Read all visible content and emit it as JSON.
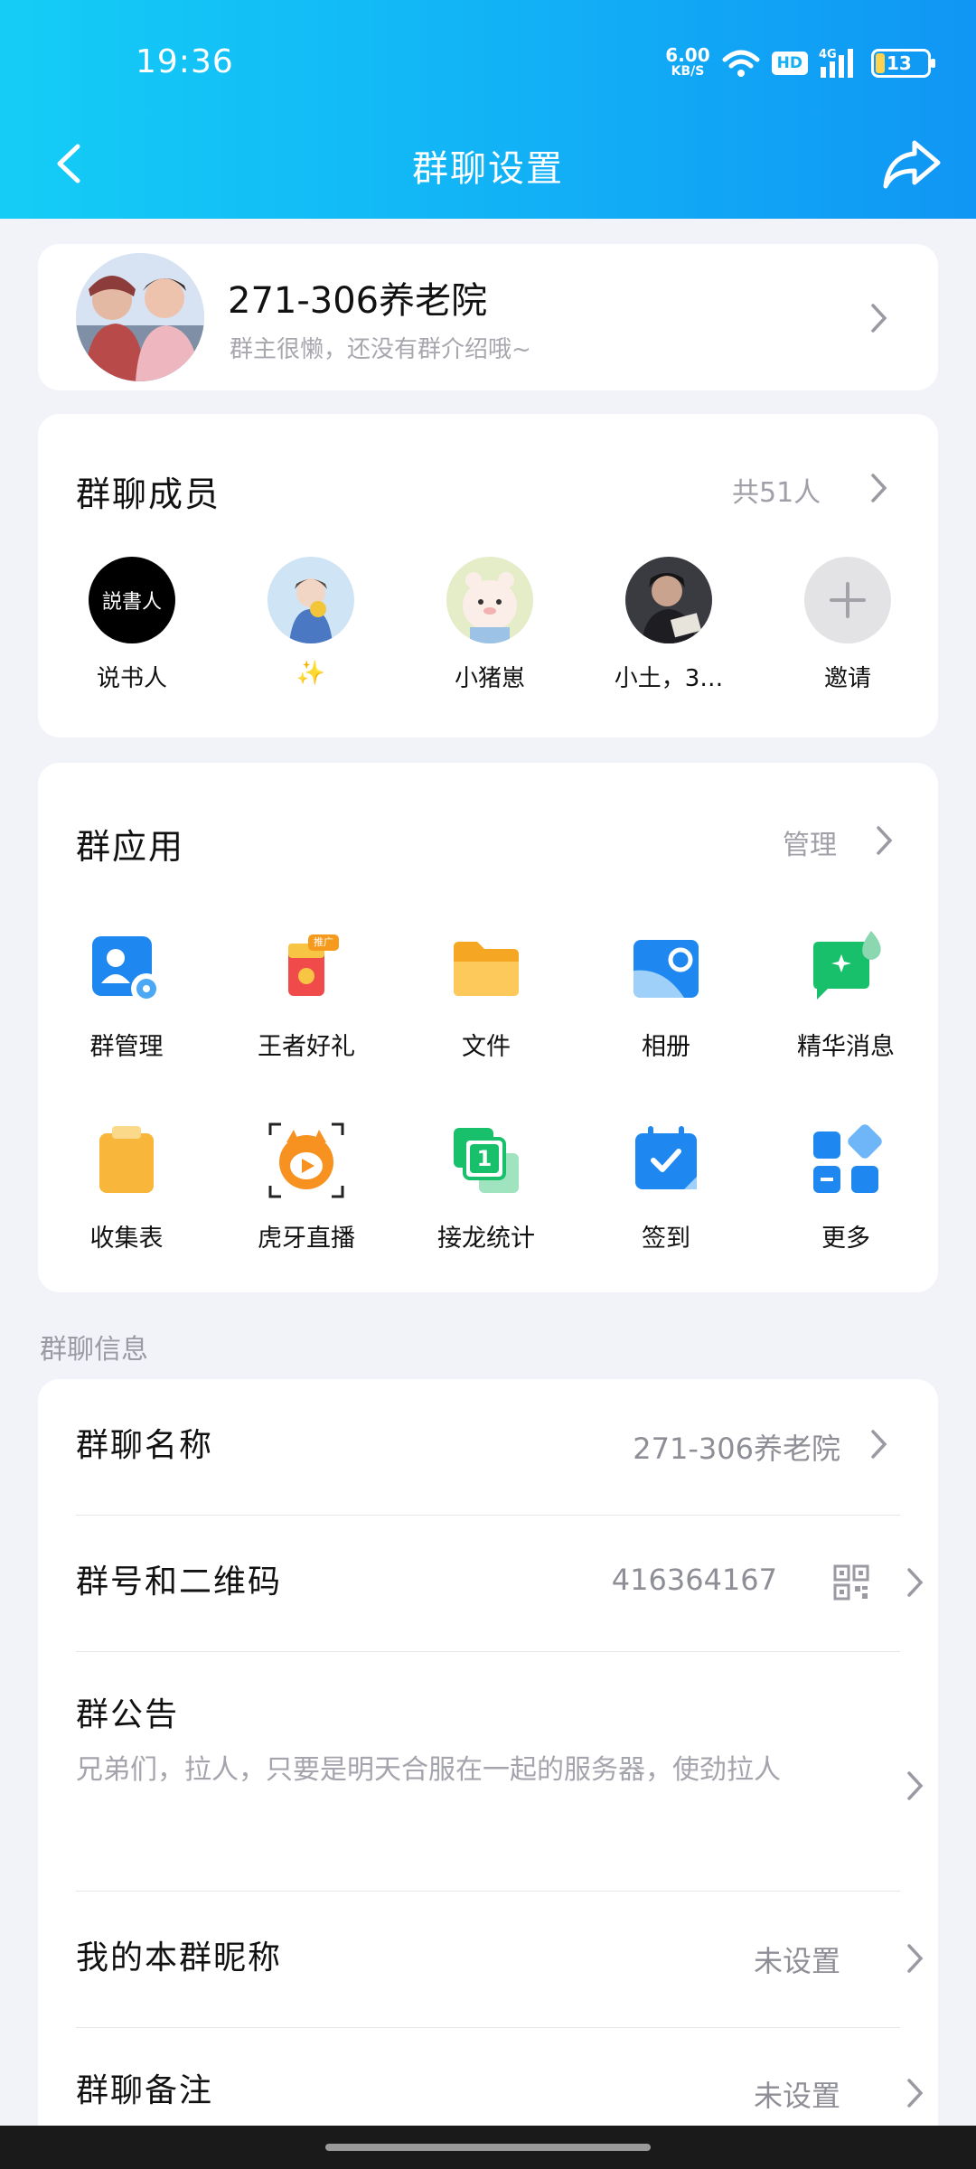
{
  "status_bar": {
    "time": "19:36",
    "speed_value": "6.00",
    "speed_unit": "KB/S",
    "hd": "HD",
    "network": "4G",
    "battery": "13"
  },
  "nav": {
    "title": "群聊设置"
  },
  "group": {
    "name": "271-306养老院",
    "description": "群主很懒，还没有群介绍哦~"
  },
  "members": {
    "title": "群聊成员",
    "count": "共51人",
    "list": [
      {
        "name": "说书人",
        "avatar_text": "説書人"
      },
      {
        "name": "✨"
      },
      {
        "name": "小猪崽"
      },
      {
        "name": "小土，3…"
      }
    ],
    "invite_label": "邀请"
  },
  "apps": {
    "title": "群应用",
    "manage": "管理",
    "items": [
      {
        "label": "群管理",
        "icon": "group-manage-icon"
      },
      {
        "label": "王者好礼",
        "icon": "gift-icon",
        "badge": "推广"
      },
      {
        "label": "文件",
        "icon": "folder-icon"
      },
      {
        "label": "相册",
        "icon": "album-icon"
      },
      {
        "label": "精华消息",
        "icon": "essence-message-icon"
      },
      {
        "label": "收集表",
        "icon": "clipboard-icon"
      },
      {
        "label": "虎牙直播",
        "icon": "huya-live-icon"
      },
      {
        "label": "接龙统计",
        "icon": "relay-stats-icon",
        "badge": "1"
      },
      {
        "label": "签到",
        "icon": "calendar-checkin-icon"
      },
      {
        "label": "更多",
        "icon": "more-apps-icon"
      }
    ]
  },
  "info": {
    "section_label": "群聊信息",
    "name_label": "群聊名称",
    "name_value": "271-306养老院",
    "number_label": "群号和二维码",
    "number_value": "416364167",
    "notice_label": "群公告",
    "notice_text": "兄弟们，拉人，只要是明天合服在一起的服务器，使劲拉人",
    "nickname_label": "我的本群昵称",
    "nickname_value": "未设置",
    "remark_label": "群聊备注",
    "remark_value": "未设置"
  },
  "colors": {
    "header_start": "#14cdf6",
    "header_end": "#1096f4",
    "accent_blue": "#1e88f0",
    "background": "#f2f3f8"
  }
}
